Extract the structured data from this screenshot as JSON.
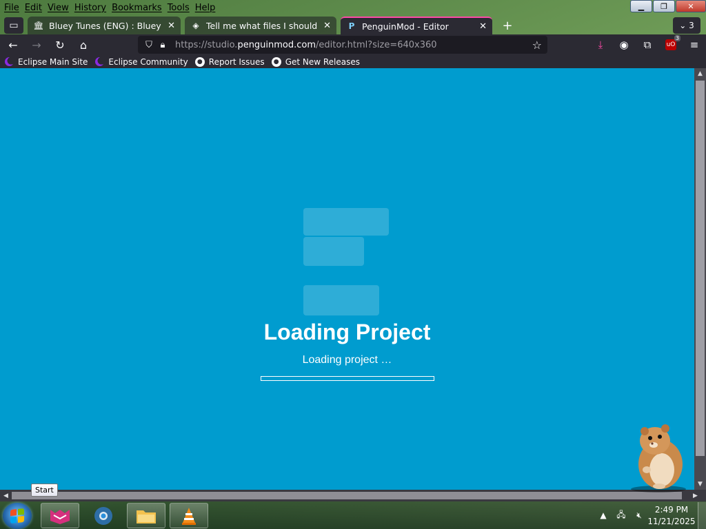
{
  "menubar": {
    "items": [
      "File",
      "Edit",
      "View",
      "History",
      "Bookmarks",
      "Tools",
      "Help"
    ]
  },
  "tabs": [
    {
      "title": "Bluey Tunes (ENG) : Bluey and A",
      "icon": "archive-icon",
      "active": false
    },
    {
      "title": "Tell me what files I should steal",
      "icon": "avatar-icon",
      "active": false
    },
    {
      "title": "PenguinMod - Editor",
      "icon": "penguinmod-icon",
      "active": true
    }
  ],
  "tab_count": "3",
  "address": {
    "prefix": "https://studio.",
    "host": "penguinmod.com",
    "path": "/editor.html?size=640x360"
  },
  "extensions": {
    "ublock_badge": "3"
  },
  "bookmarks": [
    {
      "label": "Eclipse Main Site",
      "icon": "eclipse-icon"
    },
    {
      "label": "Eclipse Community",
      "icon": "eclipse-icon"
    },
    {
      "label": "Report Issues",
      "icon": "github-icon"
    },
    {
      "label": "Get New Releases",
      "icon": "github-icon"
    }
  ],
  "loading": {
    "title": "Loading Project",
    "subtitle": "Loading project …",
    "progress": 0
  },
  "taskbar": {
    "start_tooltip": "Start",
    "time": "2:49 PM",
    "date": "11/21/2025"
  },
  "colors": {
    "stage_bg": "#009ccf",
    "browser_chrome": "#2b2a33",
    "tab_accent": "#ff4aa8"
  }
}
